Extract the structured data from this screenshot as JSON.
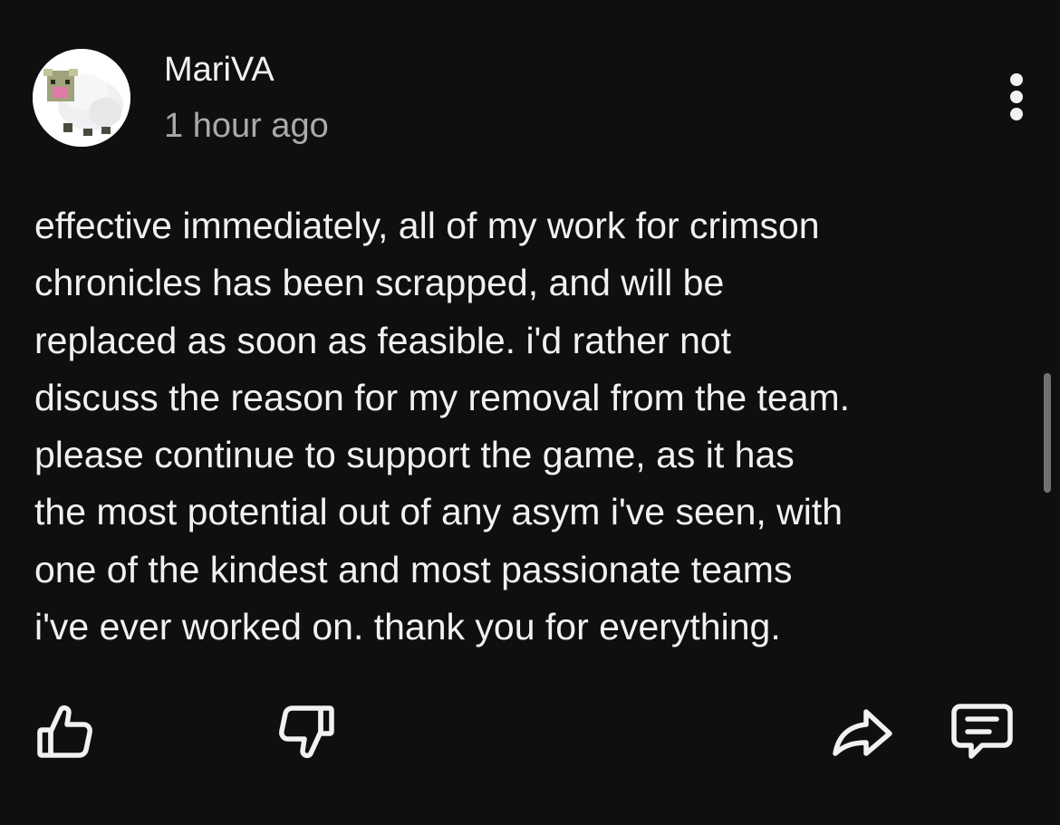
{
  "comment": {
    "username": "MariVA",
    "timestamp": "1 hour ago",
    "body_lines": [
      "effective immediately, all of my work for crimson",
      "chronicles has been scrapped, and will be",
      "replaced as soon as feasible. i'd rather not",
      "discuss the reason for my removal from the team.",
      "please continue to support the game, as it has",
      "the most potential out of any asym i've seen, with",
      "one of the kindest and most passionate teams",
      "i've ever worked on. thank you for everything."
    ]
  },
  "icons": {
    "avatar": "sheep-avatar",
    "more": "more-vert-icon",
    "like": "thumbs-up-icon",
    "dislike": "thumbs-down-icon",
    "share": "share-arrow-icon",
    "reply": "comment-icon"
  },
  "colors": {
    "background": "#0f0f0f",
    "text_primary": "#f1f1f1",
    "text_secondary": "#aaaaaa",
    "scrollbar": "#717171"
  }
}
